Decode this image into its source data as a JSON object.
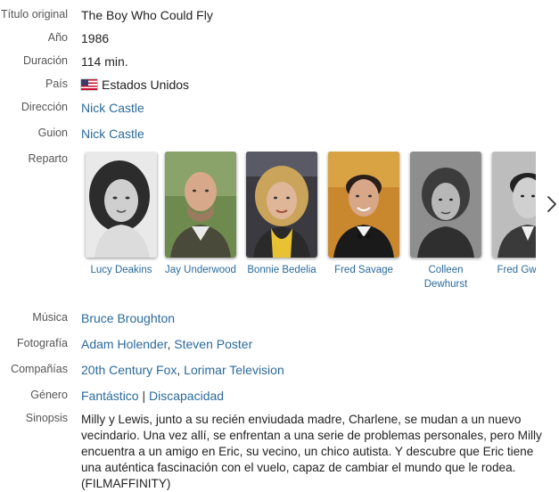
{
  "fields": {
    "titulo": {
      "label": "Título original",
      "value": "The Boy Who Could Fly"
    },
    "anio": {
      "label": "Año",
      "value": "1986"
    },
    "duracion": {
      "label": "Duración",
      "value": "114 min."
    },
    "pais": {
      "label": "País",
      "value": "Estados Unidos",
      "flag_icon": "us-flag-icon"
    },
    "direccion": {
      "label": "Dirección",
      "value": "Nick Castle"
    },
    "guion": {
      "label": "Guion",
      "value": "Nick Castle"
    },
    "reparto": {
      "label": "Reparto"
    },
    "musica": {
      "label": "Música",
      "value": "Bruce Broughton"
    },
    "fotografia": {
      "label": "Fotografía",
      "values": [
        "Adam Holender",
        "Steven Poster"
      ]
    },
    "companias": {
      "label": "Compañías",
      "values": [
        "20th Century Fox",
        "Lorimar Television"
      ]
    },
    "genero": {
      "label": "Género",
      "values": [
        "Fantástico",
        "Discapacidad"
      ],
      "separator": "|"
    },
    "sinopsis": {
      "label": "Sinopsis",
      "value": "Milly y Lewis, junto a su recién enviudada madre, Charlene, se mudan a un nuevo vecindario. Una vez allí, se enfrentan a una serie de problemas personales, pero Milly encuentra a un amigo en Eric, su vecino, un chico autista. Y descubre que Eric tiene una auténtica fascinación con el vuelo, capaz de cambiar el mundo que le rodea. (FILMAFFINITY)"
    }
  },
  "cast": [
    {
      "name": "Lucy Deakins"
    },
    {
      "name": "Jay Underwood"
    },
    {
      "name": "Bonnie Bedelia"
    },
    {
      "name": "Fred Savage"
    },
    {
      "name": "Colleen Dewhurst"
    },
    {
      "name": "Fred Gwynne"
    }
  ],
  "next_icon": "chevron-right-icon",
  "colors": {
    "link": "#2b6a9c",
    "label": "#555555",
    "text": "#222222"
  }
}
